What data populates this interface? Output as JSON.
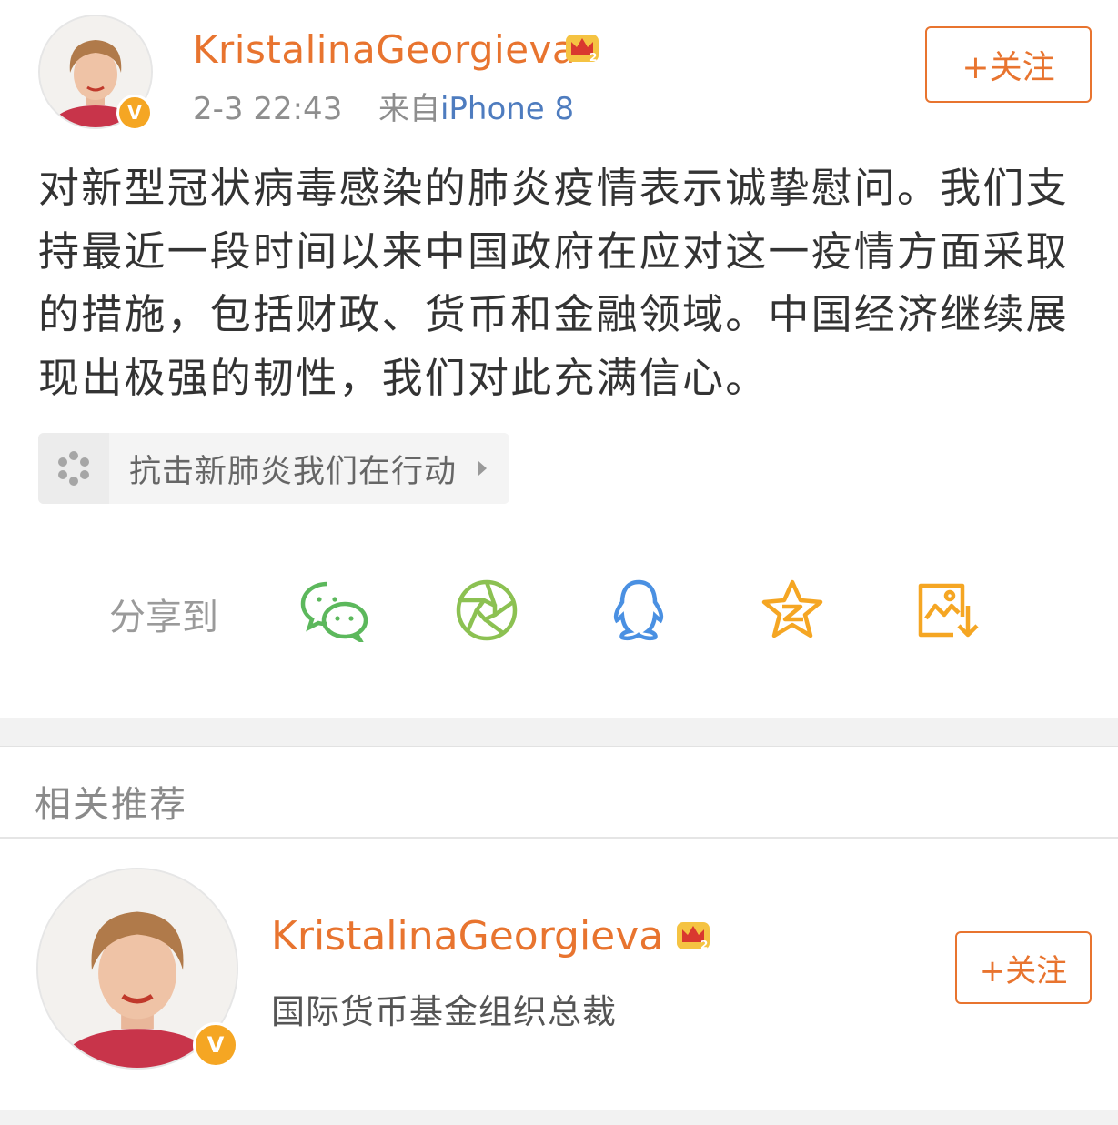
{
  "post": {
    "username": "KristalinaGeorgieva",
    "time": "2-3 22:43",
    "source_prefix": "来自",
    "source": "iPhone 8",
    "follow_label": "+关注",
    "verified_badge": "V",
    "text": "对新型冠状病毒感染的肺炎疫情表示诚挚慰问。我们支持最近一段时间以来中国政府在应对这一疫情方面采取的措施，包括财政、货币和金融领域。中国经济继续展现出极强的韧性，我们对此充满信心。",
    "topic": {
      "icon": "topic-pinwheel-icon",
      "label": "抗击新肺炎我们在行动"
    }
  },
  "share": {
    "label": "分享到",
    "targets": [
      {
        "name": "wechat",
        "icon": "wechat-icon",
        "color": "#5cb85c"
      },
      {
        "name": "moments",
        "icon": "moments-aperture-icon",
        "color": "#8cc152"
      },
      {
        "name": "qq",
        "icon": "qq-penguin-icon",
        "color": "#4a90e2"
      },
      {
        "name": "qzone",
        "icon": "qzone-star-icon",
        "color": "#f5a623"
      },
      {
        "name": "save-image",
        "icon": "save-image-icon",
        "color": "#f5a623"
      }
    ]
  },
  "recommendations": {
    "title": "相关推荐",
    "items": [
      {
        "username": "KristalinaGeorgieva",
        "description": "国际货币基金组织总裁",
        "follow_label": "+关注",
        "verified_badge": "V"
      }
    ]
  },
  "colors": {
    "accent": "#e8742f",
    "link": "#4e7cbf",
    "badge": "#f5a623"
  }
}
